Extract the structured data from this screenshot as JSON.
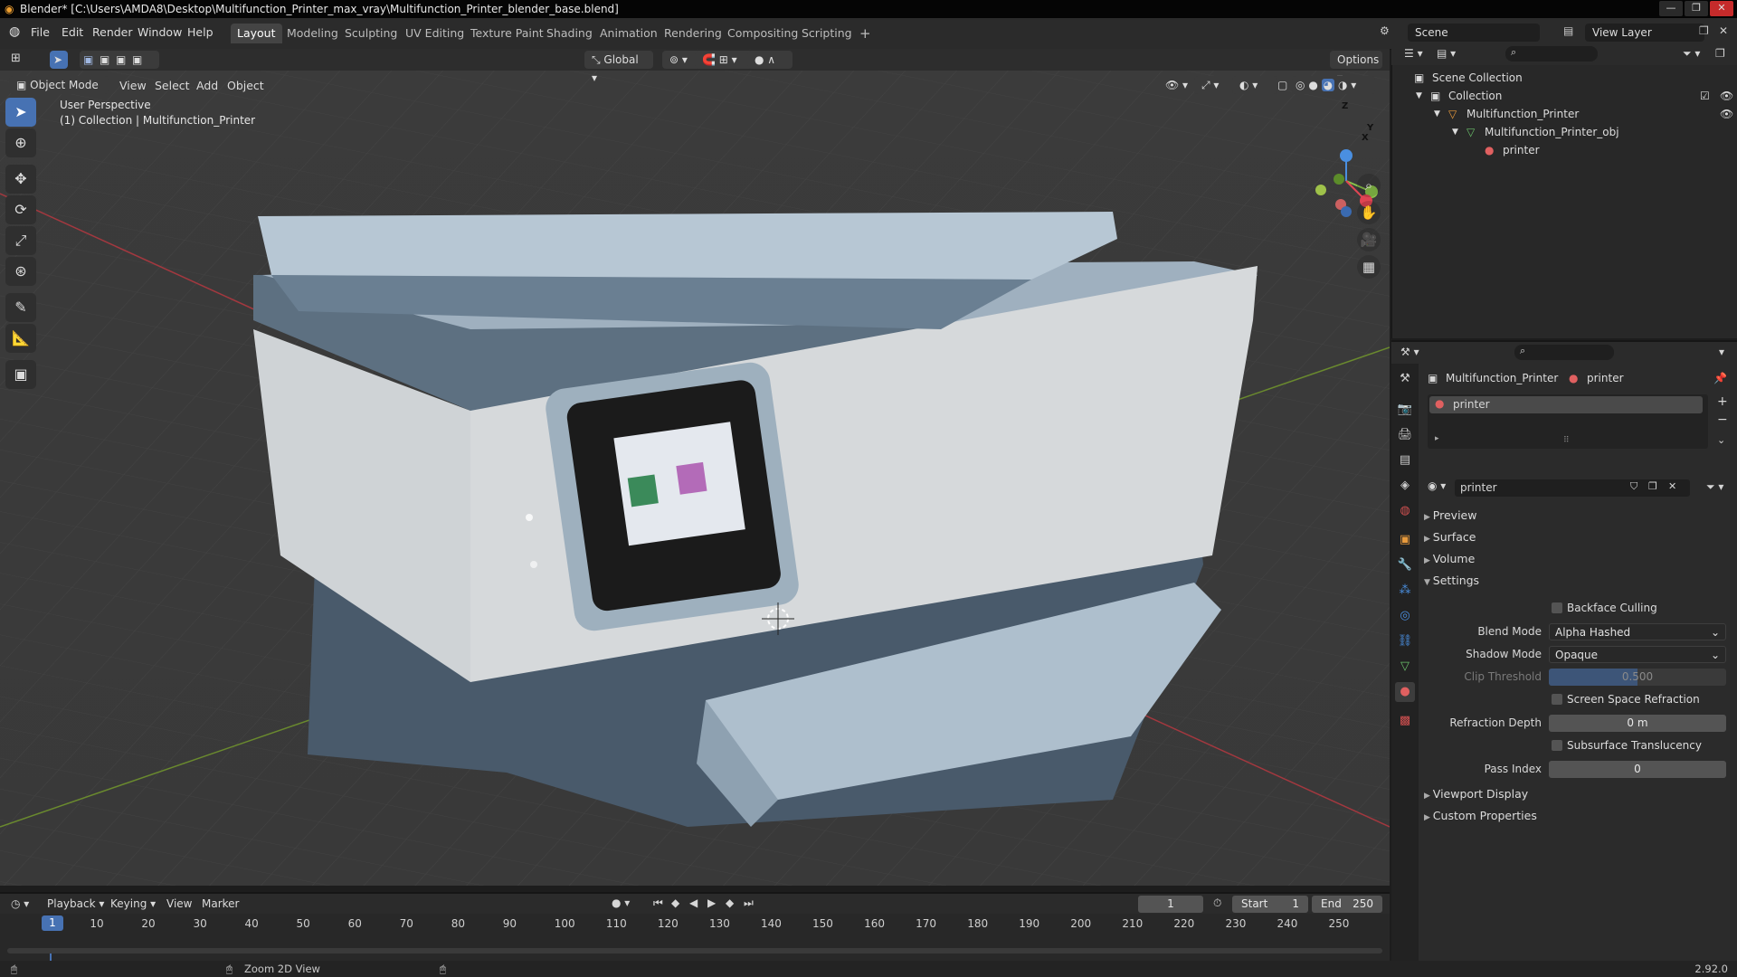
{
  "window": {
    "title": "Blender* [C:\\Users\\AMDA8\\Desktop\\Multifunction_Printer_max_vray\\Multifunction_Printer_blender_base.blend]",
    "controls": [
      "—",
      "❐",
      "✕"
    ]
  },
  "menu": [
    "File",
    "Edit",
    "Render",
    "Window",
    "Help"
  ],
  "workspaces": [
    "Layout",
    "Modeling",
    "Sculpting",
    "UV Editing",
    "Texture Paint",
    "Shading",
    "Animation",
    "Rendering",
    "Compositing",
    "Scripting"
  ],
  "scene": {
    "label": "Scene",
    "view_layer": "View Layer"
  },
  "viewport": {
    "mode": "Object Mode",
    "menus": [
      "View",
      "Select",
      "Add",
      "Object"
    ],
    "transform": "Global",
    "options": "Options",
    "perspective": "User Perspective",
    "collection_info": "(1) Collection | Multifunction_Printer",
    "axes": {
      "x": "X",
      "y": "Y",
      "z": "Z"
    }
  },
  "outliner": {
    "items": [
      {
        "label": "Scene Collection"
      },
      {
        "label": "Collection"
      },
      {
        "label": "Multifunction_Printer"
      },
      {
        "label": "Multifunction_Printer_obj"
      },
      {
        "label": "printer"
      }
    ]
  },
  "properties": {
    "object_name": "Multifunction_Printer",
    "material_name": "printer",
    "slot_name": "printer",
    "datablock_name": "printer",
    "sections": {
      "preview": "Preview",
      "surface": "Surface",
      "volume": "Volume",
      "settings": "Settings",
      "viewport_display": "Viewport Display",
      "custom_properties": "Custom Properties"
    },
    "settings": {
      "backface_culling": "Backface Culling",
      "blend_mode_label": "Blend Mode",
      "blend_mode": "Alpha Hashed",
      "shadow_mode_label": "Shadow Mode",
      "shadow_mode": "Opaque",
      "clip_threshold_label": "Clip Threshold",
      "clip_threshold": "0.500",
      "screen_space_refraction": "Screen Space Refraction",
      "refraction_depth_label": "Refraction Depth",
      "refraction_depth": "0 m",
      "subsurface_translucency": "Subsurface Translucency",
      "pass_index_label": "Pass Index",
      "pass_index": "0"
    }
  },
  "timeline": {
    "menus": [
      "Playback",
      "Keying",
      "View",
      "Marker"
    ],
    "current_frame": "1",
    "start_label": "Start",
    "start": "1",
    "end_label": "End",
    "end": "250",
    "ticks": [
      "1",
      "10",
      "20",
      "30",
      "40",
      "50",
      "60",
      "70",
      "80",
      "90",
      "100",
      "110",
      "120",
      "130",
      "140",
      "150",
      "160",
      "170",
      "180",
      "190",
      "200",
      "210",
      "220",
      "230",
      "240",
      "250"
    ]
  },
  "status": {
    "hint": "Zoom 2D View",
    "version": "2.92.0"
  },
  "colors": {
    "accent": "#4772b3",
    "x_axis": "#e04553",
    "y_axis": "#8bc34a",
    "z_axis": "#4a8fe0"
  }
}
